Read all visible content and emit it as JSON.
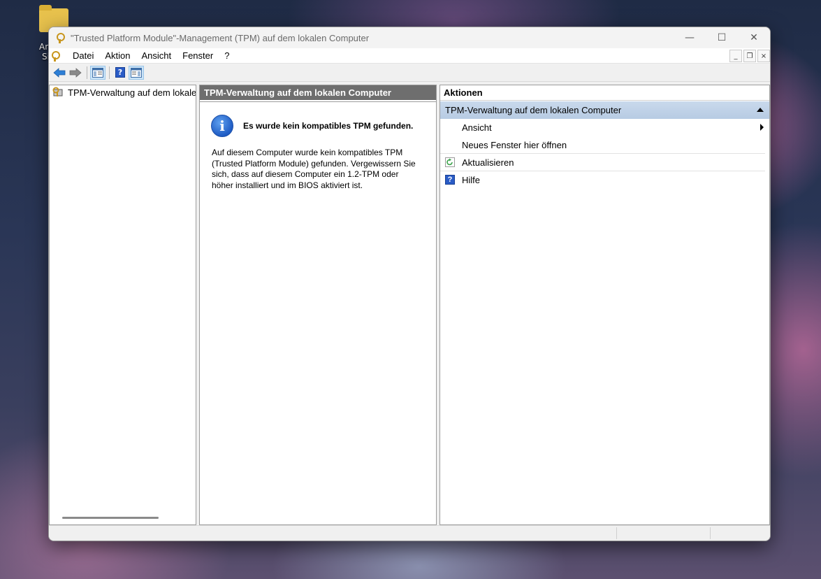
{
  "desktop": {
    "icon_label_1": "Ank",
    "icon_label_2": "Sic"
  },
  "window": {
    "title": "\"Trusted Platform Module\"-Management (TPM) auf dem lokalen Computer",
    "controls": {
      "minimize": "—",
      "maximize": "☐",
      "close": "✕"
    }
  },
  "menu": {
    "items": [
      "Datei",
      "Aktion",
      "Ansicht",
      "Fenster",
      "?"
    ],
    "mdi_controls": {
      "minimize": "_",
      "restore": "❐",
      "close": "×"
    }
  },
  "tree": {
    "root_label": "TPM-Verwaltung auf dem lokalen Computer"
  },
  "main": {
    "header": "TPM-Verwaltung auf dem lokalen Computer",
    "message_title": "Es wurde kein kompatibles TPM gefunden.",
    "message_body": "Auf diesem Computer wurde kein kompatibles TPM (Trusted Platform Module) gefunden. Vergewissern Sie sich, dass auf diesem Computer ein 1.2-TPM oder höher installiert und im BIOS aktiviert ist.",
    "info_icon_glyph": "i"
  },
  "actions": {
    "header": "Aktionen",
    "section": "TPM-Verwaltung auf dem lokalen Computer",
    "items": [
      {
        "label": "Ansicht",
        "icon": ""
      },
      {
        "label": "Neues Fenster hier öffnen",
        "icon": ""
      },
      {
        "label": "Aktualisieren",
        "icon": "refresh-icon"
      },
      {
        "label": "Hilfe",
        "icon": "help-icon"
      }
    ],
    "help_glyph": "?"
  },
  "colors": {
    "header_gray": "#6e6e6e",
    "section_blue": "#b7cbe3",
    "toolbar_pressed": "#cce4f7"
  }
}
